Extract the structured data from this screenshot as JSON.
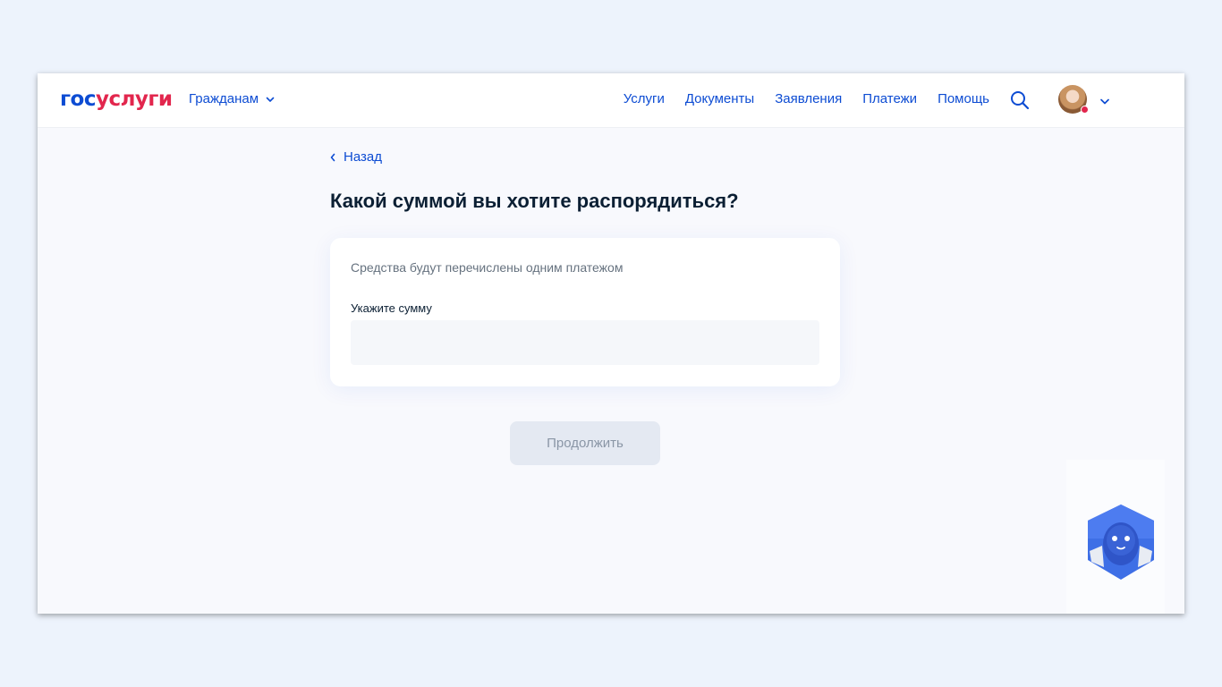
{
  "header": {
    "logo_gos": "гос",
    "logo_uslugi": "услуги",
    "audience_label": "Гражданам",
    "nav": [
      "Услуги",
      "Документы",
      "Заявления",
      "Платежи",
      "Помощь"
    ]
  },
  "main": {
    "back_label": "Назад",
    "title": "Какой суммой вы хотите распорядиться?",
    "card": {
      "subtitle": "Средства будут перечислены одним платежом",
      "field_label": "Укажите сумму",
      "field_value": "",
      "field_placeholder": ""
    },
    "continue_label": "Продолжить"
  },
  "colors": {
    "accent": "#0d4cd3",
    "brand_red": "#e2264d",
    "title": "#0b1f33"
  },
  "icons": [
    "chevron-down-icon",
    "search-icon",
    "chevron-left-icon",
    "robot-assistant-icon"
  ]
}
